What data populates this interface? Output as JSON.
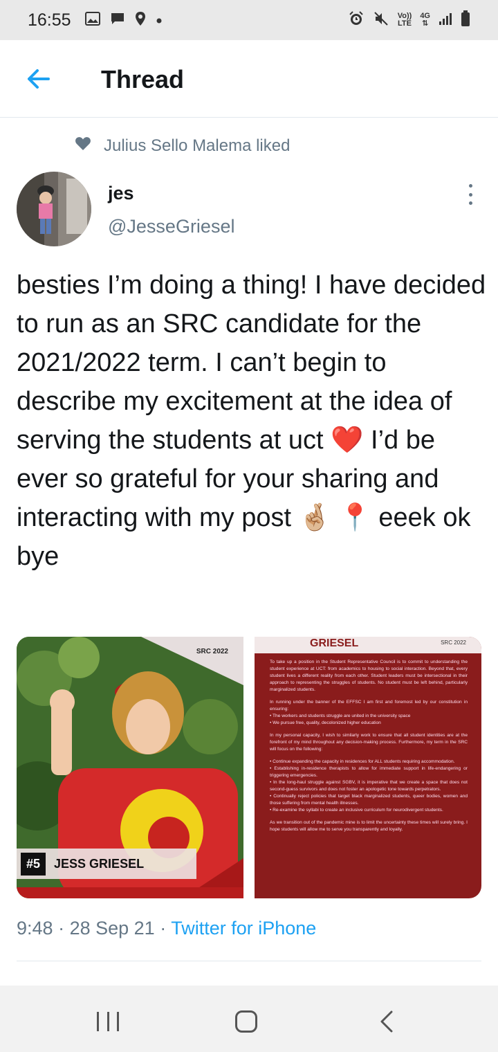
{
  "status_bar": {
    "time": "16:55",
    "left_icons": [
      "gallery-icon",
      "message-icon",
      "location-icon",
      "dot-icon"
    ],
    "right_icons": [
      "alarm-icon",
      "mute-icon",
      "volte-icon",
      "4g-icon",
      "signal-icon",
      "battery-icon"
    ],
    "volte_top": "Vo))",
    "volte_bottom": "LTE",
    "net_label": "4G"
  },
  "header": {
    "back_icon": "back-arrow-icon",
    "title": "Thread",
    "accent_color": "#1da1f2"
  },
  "social_context": {
    "icon": "heart-icon",
    "text": "Julius Sello Malema liked"
  },
  "author": {
    "display_name": "jes",
    "handle": "@JesseGriesel",
    "more_icon": "more-vertical-icon"
  },
  "tweet": {
    "text": "besties I’m doing a thing! I have decided to run as an SRC candidate for the 2021/2022 term. I can’t begin to describe my excitement at the idea of serving the students at uct ❤️ I’d be ever so grateful for your sharing and interacting with my post 🤞🏼 📍 eeek ok bye"
  },
  "media": {
    "poster": {
      "tag": "SRC 2022",
      "number": "#5",
      "name": "JESS GRIESEL"
    },
    "manifesto": {
      "name": "GRIESEL",
      "tag": "SRC 2022",
      "paragraphs": [
        "To take up a position in the Student Representative Council is to commit to understanding the student experience at UCT: from academics to housing to social interaction. Beyond that, every student lives a different reality from each other. Student leaders must be intersectional in their approach to representing the struggles of students. No student must be left behind, particularly marginalized students.",
        "In running under the banner of the EFFSC I am first and foremost led by our constitution in ensuring:",
        "• The workers and students struggle are united in the university space",
        "• We pursue free, quality, decolonized higher education",
        "In my personal capacity, I wish to similarly work to ensure that all student identities are at the forefront of my mind throughout any decision-making process. Furthermore, my term in the SRC will focus on the following:",
        "• Continue expanding the capacity in residences for ALL students requiring accommodation.",
        "• Establishing in-residence therapists to allow for immediate support in life-endangering or triggering emergencies.",
        "• In the long-haul struggle against SGBV, it is imperative that we create a space that does not second-guess survivors and does not foster an apologetic tone towards perpetrators.",
        "• Continually reject policies that target black marginalized students, queer bodies, women and those suffering from mental health illnesses.",
        "• Re-examine the syllabi to create an inclusive curriculum for neurodivergent students.",
        "As we transition out of the pandemic mine is to limit the uncertainty these times will surely bring. I hope students will allow me to serve you transparently and loyally."
      ]
    }
  },
  "meta": {
    "time": "9:48",
    "date": "28 Sep 21",
    "dot": "·",
    "source": "Twitter for iPhone"
  },
  "nav_bar": {
    "icons": [
      "recents-icon",
      "home-icon",
      "back-icon"
    ]
  }
}
